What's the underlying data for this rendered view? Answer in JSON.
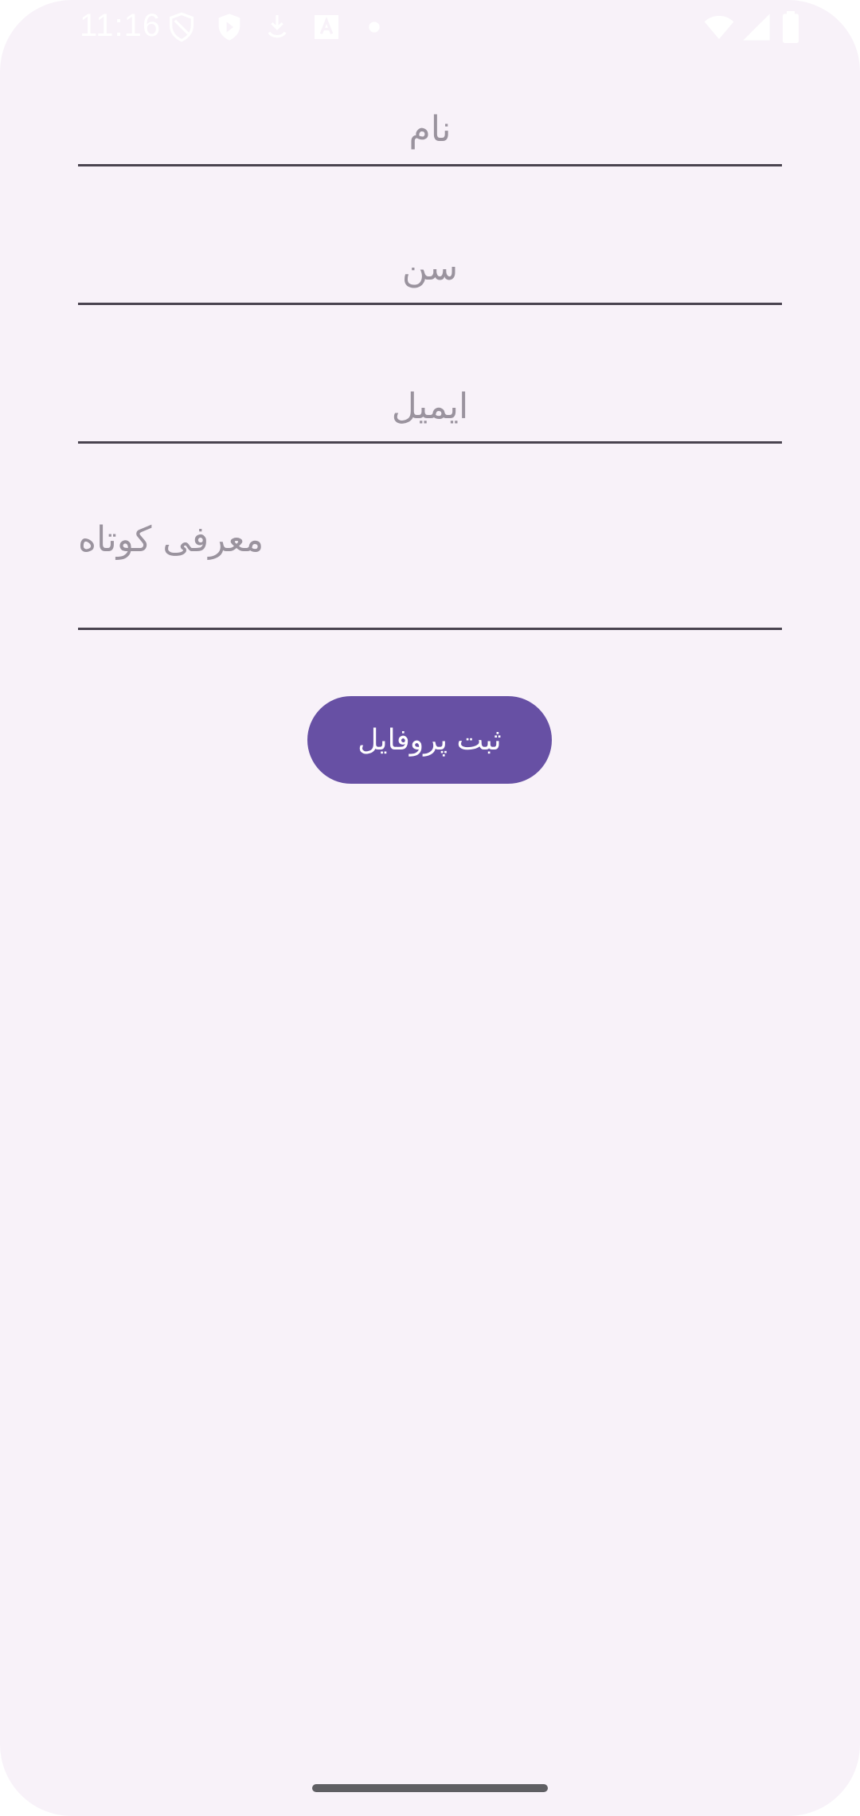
{
  "status_bar": {
    "time": "11:16",
    "icons": [
      "shield-icon",
      "play-protect-icon",
      "download-icon",
      "translate-icon",
      "dot-icon",
      "wifi-icon",
      "signal-icon",
      "battery-icon"
    ]
  },
  "form": {
    "name_placeholder": "نام",
    "age_placeholder": "سن",
    "email_placeholder": "ایمیل",
    "bio_placeholder": "معرفی کوتاه",
    "submit_label": "ثبت پروفایل"
  },
  "colors": {
    "background": "#f8f2f9",
    "primary": "#6750a4",
    "underline": "#4a4450",
    "placeholder": "#9a939e"
  }
}
